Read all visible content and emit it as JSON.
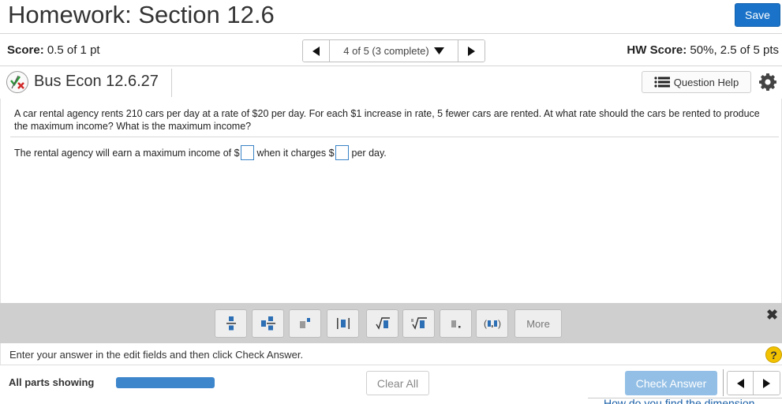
{
  "header": {
    "title": "Homework: Section 12.6",
    "save_label": "Save"
  },
  "score_bar": {
    "score_label": "Score:",
    "score_value": "0.5 of 1 pt",
    "nav_status": "4 of 5 (3 complete)",
    "hw_score_label": "HW Score:",
    "hw_score_value": "50%, 2.5 of 5 pts"
  },
  "question_bar": {
    "question_name": "Bus Econ 12.6.27",
    "help_label": "Question Help",
    "icons": {
      "status": "partial-credit-icon",
      "help": "list-icon",
      "settings": "gear-icon"
    }
  },
  "question": {
    "text": "A car rental agency rents 210 cars per day at a rate of $20 per day. For each $1 increase in rate, 5 fewer cars are rented. At what rate should the cars be rented to produce the maximum income? What is the maximum income?",
    "answer_part1": "The rental agency will earn a maximum income of $",
    "answer_part2": "when it charges $",
    "answer_part3": "per day."
  },
  "palette": {
    "tools": [
      "fraction",
      "mixed number",
      "exponent",
      "absolute value",
      "square root",
      "nth root",
      "decimal",
      "interval",
      "More"
    ],
    "more_label": "More"
  },
  "instructions": "Enter your answer in the edit fields and then click Check Answer.",
  "bottom_bar": {
    "parts_label": "All parts showing",
    "progress": 1.0,
    "clear_label": "Clear All",
    "check_label": "Check Answer"
  },
  "footer_link": "How do you find the dimension",
  "colors": {
    "primary": "#1a73c9",
    "progress": "#3d86cc",
    "check_disabled": "#93bfe6",
    "help": "#f2c200"
  }
}
